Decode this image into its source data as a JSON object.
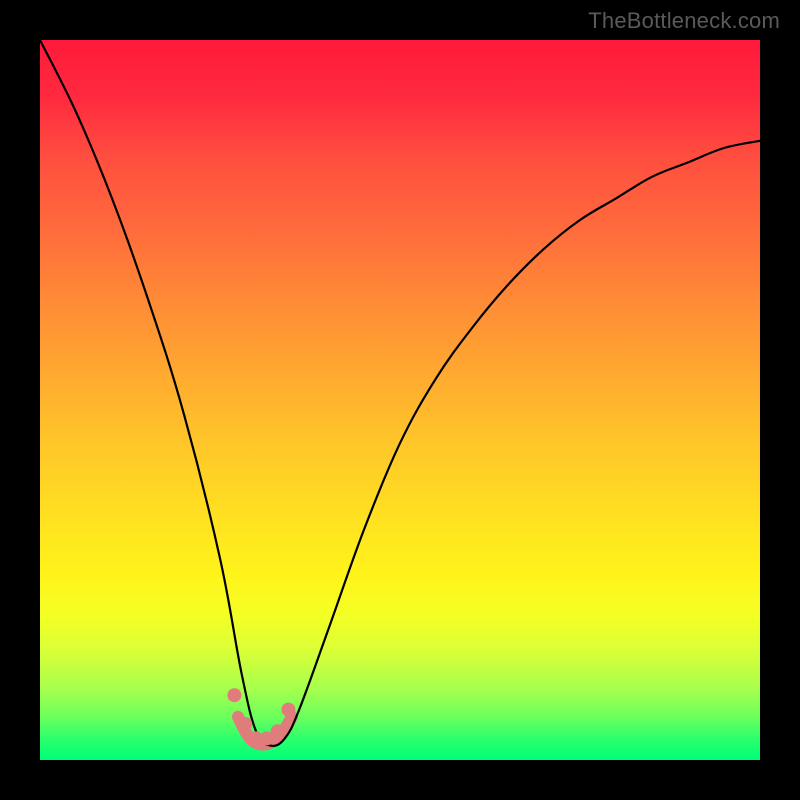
{
  "watermark": "TheBottleneck.com",
  "chart_data": {
    "type": "line",
    "title": "",
    "xlabel": "",
    "ylabel": "",
    "xlim": [
      0,
      100
    ],
    "ylim": [
      0,
      100
    ],
    "grid": false,
    "legend": false,
    "series": [
      {
        "name": "bottleneck-curve",
        "x": [
          0,
          5,
          10,
          15,
          20,
          25,
          28,
          30,
          32,
          34,
          36,
          40,
          45,
          50,
          55,
          60,
          65,
          70,
          75,
          80,
          85,
          90,
          95,
          100
        ],
        "values": [
          100,
          90,
          78,
          64,
          48,
          28,
          12,
          4,
          2,
          3,
          7,
          18,
          32,
          44,
          53,
          60,
          66,
          71,
          75,
          78,
          81,
          83,
          85,
          86
        ]
      }
    ],
    "markers": {
      "name": "optimal-range-markers",
      "x": [
        27,
        28.5,
        30,
        31.5,
        33,
        34.5
      ],
      "values": [
        9,
        5,
        3,
        3,
        4,
        7
      ]
    },
    "trough": {
      "name": "optimal-range-band",
      "x": [
        27.5,
        29,
        30.5,
        32,
        33.5,
        35
      ],
      "values": [
        6,
        3.2,
        2.2,
        2.4,
        3.6,
        6
      ]
    },
    "colors": {
      "curve": "#000000",
      "marker": "#e17c7c",
      "trough": "#e17c7c",
      "gradient_top": "#ff1a3a",
      "gradient_bottom": "#00ff7a"
    }
  }
}
